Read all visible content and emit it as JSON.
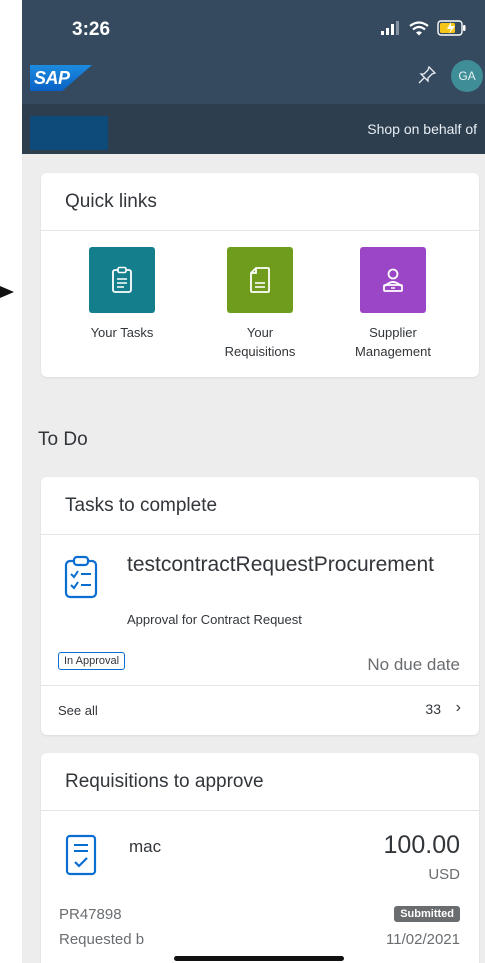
{
  "status": {
    "time": "3:26"
  },
  "shell": {
    "logo": "SAP",
    "avatar_initials": "GA"
  },
  "subheader": {
    "shop_link": "Shop on behalf of"
  },
  "quick_links": {
    "title": "Quick links",
    "items": [
      {
        "label": "Your Tasks",
        "icon": "clipboard-icon",
        "color": "#147e8c"
      },
      {
        "label": "Your\nRequisitions",
        "icon": "document-icon",
        "color": "#6f9c1c"
      },
      {
        "label": "Supplier\nManagement",
        "icon": "supplier-icon",
        "color": "#9b45c7"
      }
    ]
  },
  "todo": {
    "title": "To Do"
  },
  "tasks": {
    "title": "Tasks to complete",
    "item": {
      "name": "testcontractRequestProcurement",
      "subtitle": "Approval for Contract Request",
      "badge": "In Approval",
      "due": "No due date"
    },
    "see_all": "See all",
    "count": "33"
  },
  "requisitions": {
    "title": "Requisitions to approve",
    "item": {
      "name": "mac",
      "amount": "100.00",
      "currency": "USD",
      "id": "PR47898",
      "status": "Submitted",
      "requested_by": "Requested b",
      "date": "11/02/2021"
    }
  },
  "colors": {
    "shell": "#354a5f",
    "subbar": "#2d3e4f",
    "accent": "#0a6ed1"
  }
}
